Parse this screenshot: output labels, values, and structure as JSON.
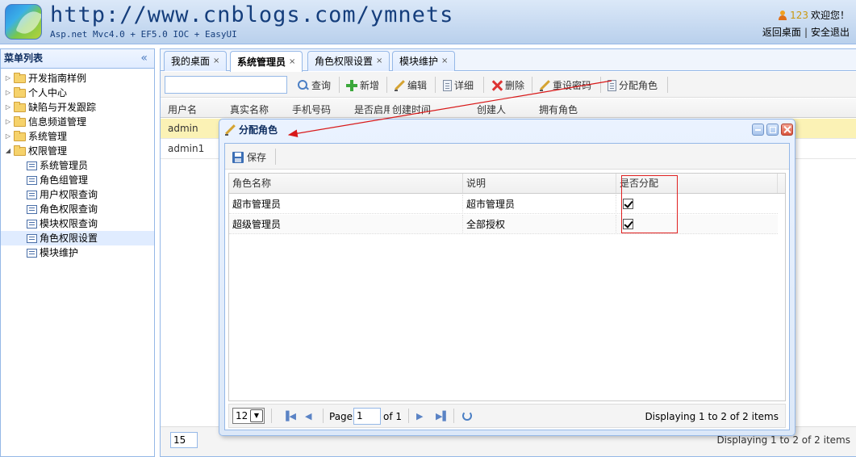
{
  "header": {
    "site_url": "http://www.cnblogs.com/ymnets",
    "subtitle": "Asp.net Mvc4.0 + EF5.0 IOC + EasyUI",
    "user_name": "123",
    "welcome": "欢迎您！",
    "link_home": "返回桌面",
    "link_sep": "|",
    "link_logout": "安全退出",
    "user_color": "#c99810"
  },
  "sidebar": {
    "title": "菜单列表",
    "collapse": "«",
    "items": [
      {
        "label": "开发指南样例",
        "type": "folder",
        "expanded": false
      },
      {
        "label": "个人中心",
        "type": "folder",
        "expanded": false
      },
      {
        "label": "缺陷与开发跟踪",
        "type": "folder",
        "expanded": false
      },
      {
        "label": "信息频道管理",
        "type": "folder",
        "expanded": false
      },
      {
        "label": "系统管理",
        "type": "folder",
        "expanded": false
      },
      {
        "label": "权限管理",
        "type": "folder",
        "expanded": true
      },
      {
        "label": "系统管理员",
        "type": "leaf"
      },
      {
        "label": "角色组管理",
        "type": "leaf"
      },
      {
        "label": "用户权限查询",
        "type": "leaf"
      },
      {
        "label": "角色权限查询",
        "type": "leaf"
      },
      {
        "label": "模块权限查询",
        "type": "leaf"
      },
      {
        "label": "角色权限设置",
        "type": "leaf",
        "selected": true
      },
      {
        "label": "模块维护",
        "type": "leaf"
      }
    ]
  },
  "tabs": [
    {
      "label": "我的桌面",
      "close": "×"
    },
    {
      "label": "系统管理员",
      "close": "×",
      "active": true
    },
    {
      "label": "角色权限设置",
      "close": "×"
    },
    {
      "label": "模块维护",
      "close": "×"
    }
  ],
  "toolbar": {
    "search": "查询",
    "add": "新增",
    "edit": "编辑",
    "detail": "详细",
    "delete": "删除",
    "reset_password": "重设密码",
    "assign_role": "分配角色"
  },
  "grid": {
    "columns": [
      "用户名",
      "真实名称",
      "手机号码",
      "是否启用",
      "创建时间",
      "创建人",
      "拥有角色"
    ],
    "rows": [
      {
        "username": "admin",
        "selected": true
      },
      {
        "username": "admin1",
        "selected": false
      }
    ]
  },
  "main_pager": {
    "page_size": "15",
    "display": "Displaying 1 to 2 of 2 items"
  },
  "dialog": {
    "title": "分配角色",
    "save": "保存",
    "columns": [
      "角色名称",
      "说明",
      "是否分配"
    ],
    "rows": [
      {
        "name": "超市管理员",
        "desc": "超市管理员",
        "assigned": true
      },
      {
        "name": "超级管理员",
        "desc": "全部授权",
        "assigned": true
      }
    ],
    "pager": {
      "page_size": "12",
      "page_label": "Page",
      "page_value": "1",
      "of_label": "of 1",
      "display": "Displaying 1 to 2 of 2 items"
    }
  }
}
